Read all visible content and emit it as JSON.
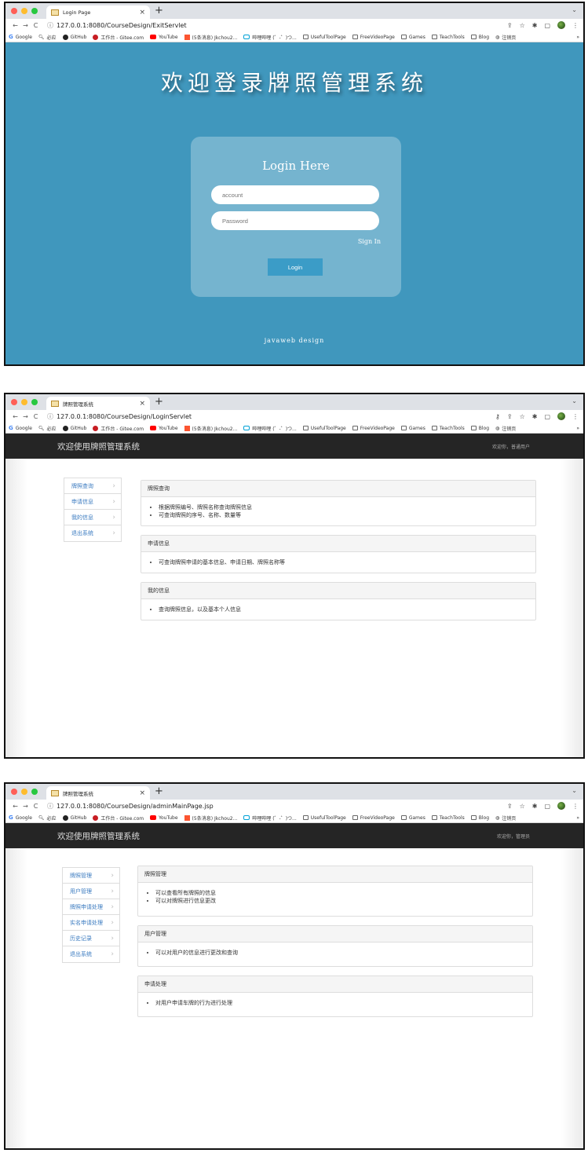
{
  "browser": {
    "bookmarks": [
      "Google",
      "必应",
      "GitHub",
      "工作台 - Gitee.com",
      "YouTube",
      "(5条消息) Jkchou2...",
      "哔哩哔哩 (゜-゜)つ...",
      "UsefulToolPage",
      "FreeVideoPage",
      "Games",
      "TeachTools",
      "Blog",
      "注销页"
    ],
    "more": "»"
  },
  "shot1": {
    "tab_title": "Login Page",
    "url": "127.0.0.1:8080/CourseDesign/ExitServlet",
    "heading": "欢迎登录牌照管理系统",
    "card_title": "Login Here",
    "account_placeholder": "account",
    "password_placeholder": "Password",
    "sign_in": "Sign In",
    "login_button": "Login",
    "footer": "javaweb design"
  },
  "shot2": {
    "tab_title": "牌照管理系统",
    "url": "127.0.0.1:8080/CourseDesign/LoginServlet",
    "brand": "欢迎使用牌照管理系统",
    "welcome": "欢迎你，普通用户",
    "menu": [
      "牌照查询",
      "申请信息",
      "我的信息",
      "退出系统"
    ],
    "panels": [
      {
        "title": "牌照查询",
        "items": [
          "根据牌照编号、牌照名称查询牌照信息",
          "可查询牌照的序号、名称、数量等"
        ]
      },
      {
        "title": "申请信息",
        "items": [
          "可查询牌照申请的基本信息、申请日期、牌照名称等"
        ]
      },
      {
        "title": "我的信息",
        "items": [
          "查询牌照信息，以及基本个人信息"
        ]
      }
    ]
  },
  "shot3": {
    "tab_title": "牌照管理系统",
    "url": "127.0.0.1:8080/CourseDesign/adminMainPage.jsp",
    "brand": "欢迎使用牌照管理系统",
    "welcome": "欢迎你，管理员",
    "menu": [
      "牌照管理",
      "用户管理",
      "牌照申请处理",
      "实名申请处理",
      "历史记录",
      "退出系统"
    ],
    "panels": [
      {
        "title": "牌照管理",
        "items": [
          "可以查看所有牌照的信息",
          "可以对牌照进行信息更改"
        ]
      },
      {
        "title": "用户管理",
        "items": [
          "可以对用户的信息进行更改和查询"
        ]
      },
      {
        "title": "申请处理",
        "items": [
          "对用户申请车牌的行为进行处理"
        ]
      }
    ]
  },
  "colors": {
    "login_bg": "#4097bd",
    "navbar": "#252525",
    "menu_link": "#3b7bc0",
    "login_button": "#3b9cc7"
  }
}
